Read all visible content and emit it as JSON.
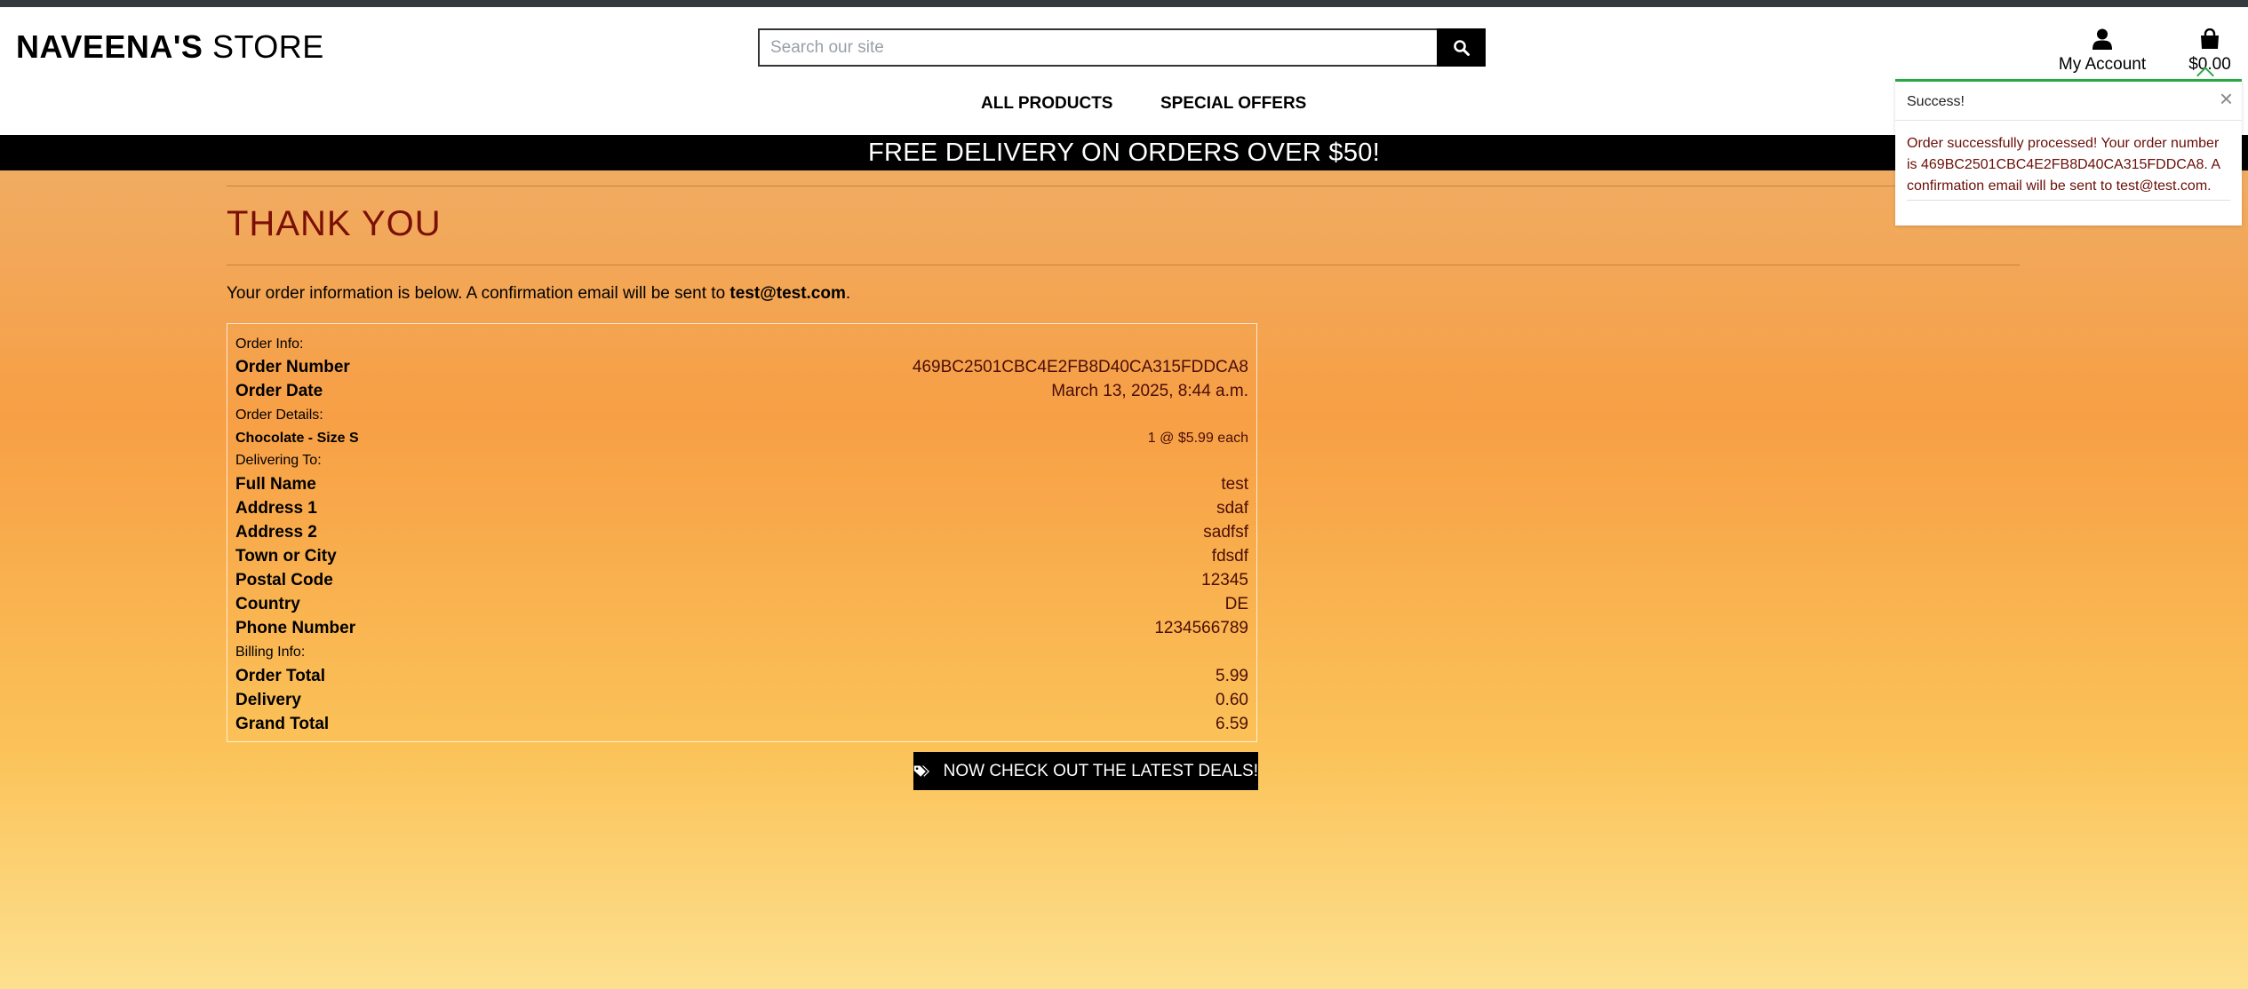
{
  "store": {
    "name_bold": "NAVEENA'S",
    "name_rest": "STORE"
  },
  "search": {
    "placeholder": "Search our site"
  },
  "account": {
    "label": "My Account"
  },
  "bag": {
    "total": "$0.00"
  },
  "nav": {
    "all_products": "ALL PRODUCTS",
    "special_offers": "SPECIAL OFFERS"
  },
  "banner": {
    "text": "FREE DELIVERY ON ORDERS OVER $50!"
  },
  "page": {
    "title": "THANK YOU",
    "intro_prefix": "Your order information is below. A confirmation email will be sent to ",
    "email": "test@test.com",
    "intro_suffix": "."
  },
  "order": {
    "info_label": "Order Info:",
    "order_number_label": "Order Number",
    "order_number": "469BC2501CBC4E2FB8D40CA315FDDCA8",
    "order_date_label": "Order Date",
    "order_date": "March 13, 2025, 8:44 a.m.",
    "details_label": "Order Details:",
    "item_name": "Chocolate - Size S",
    "item_qty": "1 @ $5.99 each",
    "delivering_label": "Delivering To:",
    "full_name_label": "Full Name",
    "full_name": "test",
    "address1_label": "Address 1",
    "address1": "sdaf",
    "address2_label": "Address 2",
    "address2": "sadfsf",
    "town_label": "Town or City",
    "town": "fdsdf",
    "postal_label": "Postal Code",
    "postal": "12345",
    "country_label": "Country",
    "country": "DE",
    "phone_label": "Phone Number",
    "phone": "1234566789",
    "billing_label": "Billing Info:",
    "order_total_label": "Order Total",
    "order_total": "5.99",
    "delivery_label": "Delivery",
    "delivery": "0.60",
    "grand_total_label": "Grand Total",
    "grand_total": "6.59"
  },
  "deals_button": {
    "label": "NOW CHECK OUT THE LATEST DEALS!"
  },
  "toast": {
    "title": "Success!",
    "close": "×",
    "message": "Order successfully processed! Your order number is 469BC2501CBC4E2FB8D40CA315FDDCA8. A confirmation email will be sent to test@test.com."
  },
  "colors": {
    "accent_title": "#7a0f06",
    "toast_border": "#28a745",
    "banner_bg": "#000000"
  },
  "icons": [
    "search-icon",
    "user-icon",
    "shopping-bag-icon",
    "close-icon",
    "tags-icon"
  ]
}
